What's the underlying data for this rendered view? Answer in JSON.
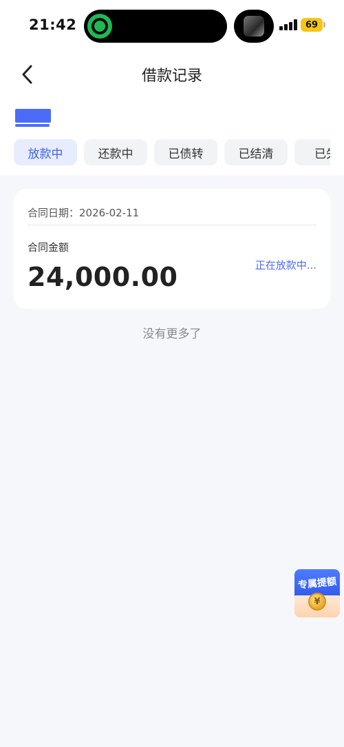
{
  "status_bar": {
    "time": "21:42",
    "battery": "69"
  },
  "header": {
    "title": "借款记录"
  },
  "tabs": [
    {
      "label": "放款中",
      "active": true
    },
    {
      "label": "还款中",
      "active": false
    },
    {
      "label": "已债转",
      "active": false
    },
    {
      "label": "已结清",
      "active": false
    },
    {
      "label": "已失",
      "active": false
    }
  ],
  "card": {
    "contract_date": "合同日期：2026-02-11",
    "amount_label": "合同金额",
    "amount_value": "24,000.00",
    "status": "正在放款中..."
  },
  "footer_note": "没有更多了",
  "float_badge": {
    "label": "专属提额",
    "coin_symbol": "¥"
  },
  "colors": {
    "accent": "#4a6cf7",
    "active_tab_bg": "#e7edff",
    "page_bg": "#f6f7fb"
  }
}
